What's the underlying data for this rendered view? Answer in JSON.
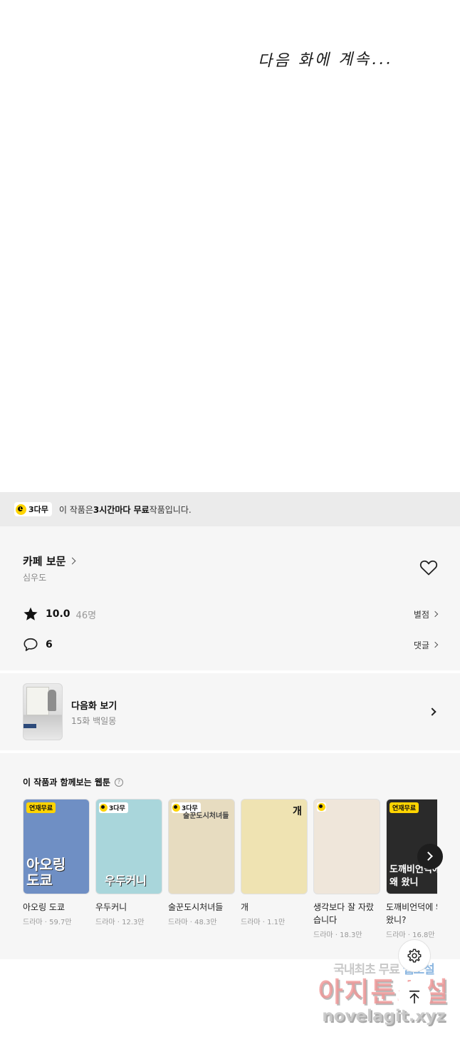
{
  "comic": {
    "handwritten_text": "다음 화에 계속..."
  },
  "free_banner": {
    "badge": "3다무",
    "text_pre": "이 작품은 ",
    "text_bold": "3시간마다 무료",
    "text_post": " 작품입니다."
  },
  "info": {
    "title": "카페 보문",
    "author": "심우도",
    "rating": "10.0",
    "rating_count": "46명",
    "rating_link": "별점",
    "comments": "6",
    "comments_link": "댓글"
  },
  "next_episode": {
    "label": "다음화 보기",
    "subtitle": "15화 백일몽"
  },
  "recommendations": {
    "heading": "이 작품과 함께보는 웹툰",
    "help": "?",
    "items": [
      {
        "title": "아오링 도쿄",
        "meta": "드라마 · 59.7만",
        "tag": "연재무료",
        "cover_text": "아오링 도쿄",
        "bg": "#6f8fc4"
      },
      {
        "title": "우두커니",
        "meta": "드라마 · 12.3만",
        "tag": "3다무",
        "cover_text": "우두커니",
        "bg": "#a9d6db"
      },
      {
        "title": "술꾼도시처녀들",
        "meta": "드라마 · 48.3만",
        "tag": "3다무",
        "cover_text": "술꾼도시처녀들",
        "bg": "#e7dcc0"
      },
      {
        "title": "개",
        "meta": "드라마 · 1.1만",
        "tag": "",
        "cover_text": "개",
        "bg": "#efe3b2"
      },
      {
        "title": "생각보다 잘 자랐습니다",
        "meta": "드라마 · 18.3만",
        "tag": "",
        "cover_text": "",
        "bg": "#efe6da"
      },
      {
        "title": "도깨비언덕에 왜 왔니?",
        "meta": "드라마 · 16.8만",
        "tag": "연재무료",
        "cover_text": "도깨비언덕에 왜 왔니",
        "bg": "#2a2a2a"
      }
    ]
  },
  "watermark": {
    "line1_a": "국내최초 무료",
    "line1_b": "웹소설",
    "line2": "아지툰소설",
    "line3": "novelagit.xyz"
  }
}
